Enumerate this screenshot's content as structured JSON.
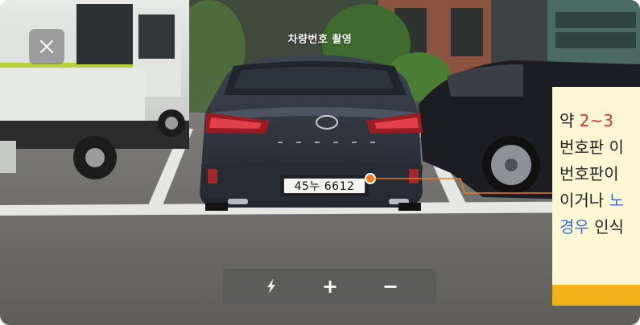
{
  "header": {
    "title": "차량번호 촬영"
  },
  "controls": {
    "close_icon": "close-icon",
    "flash_icon": "flash-icon",
    "zoom_in_label": "+",
    "zoom_out_label": "−"
  },
  "plate": {
    "number": "45누 6612"
  },
  "guide": {
    "line1_prefix": "약 ",
    "line1_highlight": "2~3",
    "line2": "번호판 이",
    "line3": "번호판이",
    "line4_prefix": "이거나 ",
    "line4_highlight": "노",
    "line5_highlight": "경우",
    "line5_suffix": " 인식"
  },
  "colors": {
    "accent_orange": "#f07a1d",
    "guide_bg": "#fff6d6",
    "guide_bar": "#f2b21a",
    "highlight_red": "#e22b2b",
    "highlight_blue": "#3a6fc4"
  }
}
